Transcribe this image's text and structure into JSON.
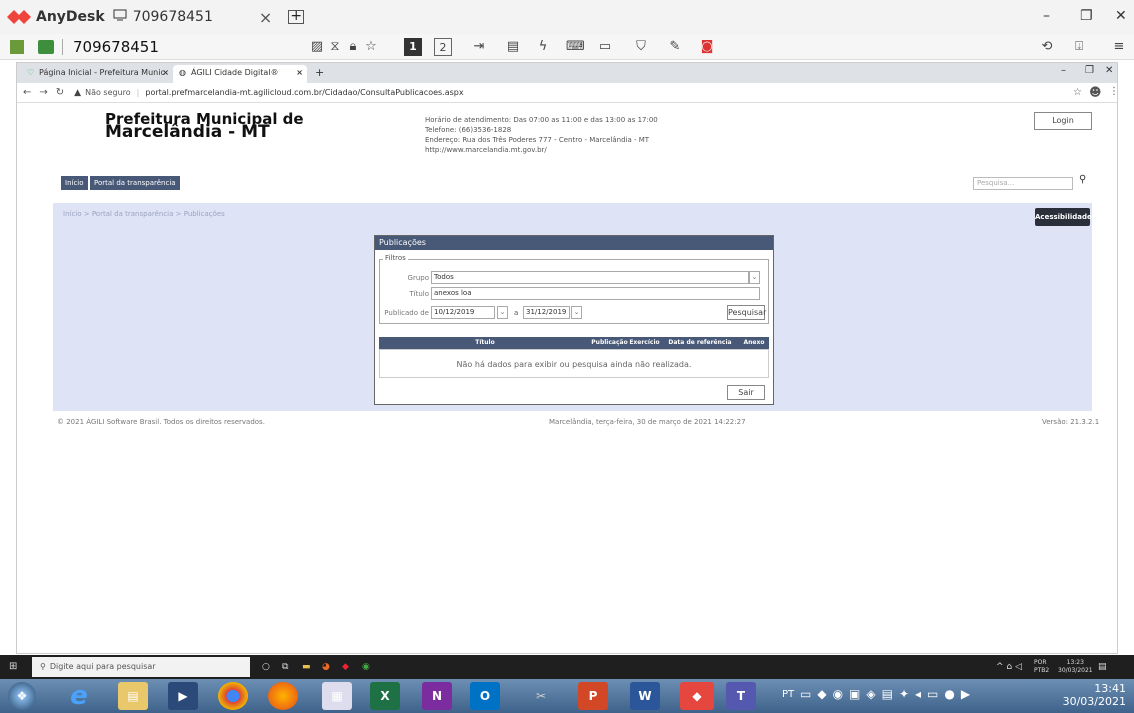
{
  "anydesk": {
    "brand": "AnyDesk",
    "tab_label": "709678451",
    "tab_close": "×",
    "address": "709678451",
    "toolbar_num1": "1",
    "toolbar_num2": "2"
  },
  "browser": {
    "tabs": [
      {
        "label": "Página Inicial - Prefeitura Munic"
      },
      {
        "label": "ÁGILI Cidade Digital®"
      }
    ],
    "tab_close": "×",
    "new_tab": "+",
    "not_secure": "Não seguro",
    "url": "portal.prefmarcelandia-mt.agilicloud.com.br/Cidadao/ConsultaPublicacoes.aspx"
  },
  "header": {
    "title_line1": "Prefeitura Municipal de",
    "title_line2": "Marcelândia - MT",
    "info_lines": [
      "Horário de atendimento: Das 07:00 as 11:00 e das 13:00 as 17:00",
      "Telefone: (66)3536-1828",
      "Endereço: Rua dos Três Poderes 777 - Centro - Marcelândia - MT",
      "http://www.marcelandia.mt.gov.br/"
    ],
    "login_label": "Login"
  },
  "nav": {
    "items": [
      {
        "label": "Início"
      },
      {
        "label": "Portal da transparência"
      }
    ],
    "search_placeholder": "Pesquisa..."
  },
  "breadcrumb": "Início > Portal da transparência > Publicações",
  "accessibility_label": "Acessibilidade",
  "panel": {
    "title": "Publicações",
    "filters_legend": "Filtros",
    "group_label": "Grupo",
    "group_value": "Todos",
    "title_label": "Título",
    "title_value": "anexos loa",
    "published_label": "Publicado de",
    "date_from": "10/12/2019",
    "date_sep": "a",
    "date_to": "31/12/2019",
    "search_button": "Pesquisar",
    "columns": [
      "Título",
      "Publicação",
      "Exercício",
      "Data de referência",
      "Anexo"
    ],
    "empty_message": "Não há dados para exibir ou pesquisa ainda não realizada.",
    "exit_button": "Sair"
  },
  "footer": {
    "copyright": "© 2021 ÁGILI Software Brasil. Todos os direitos reservados.",
    "datetime": "Marcelândia, terça-feira, 30 de março de 2021 14:22:27",
    "version": "Versão: 21.3.2.1"
  },
  "remote_taskbar": {
    "search_placeholder": "Digite aqui para pesquisar",
    "lang": "POR",
    "lang2": "PTB2",
    "time": "13:23",
    "date": "30/03/2021"
  },
  "local_taskbar": {
    "lang": "PT",
    "time": "13:41",
    "date": "30/03/2021"
  }
}
